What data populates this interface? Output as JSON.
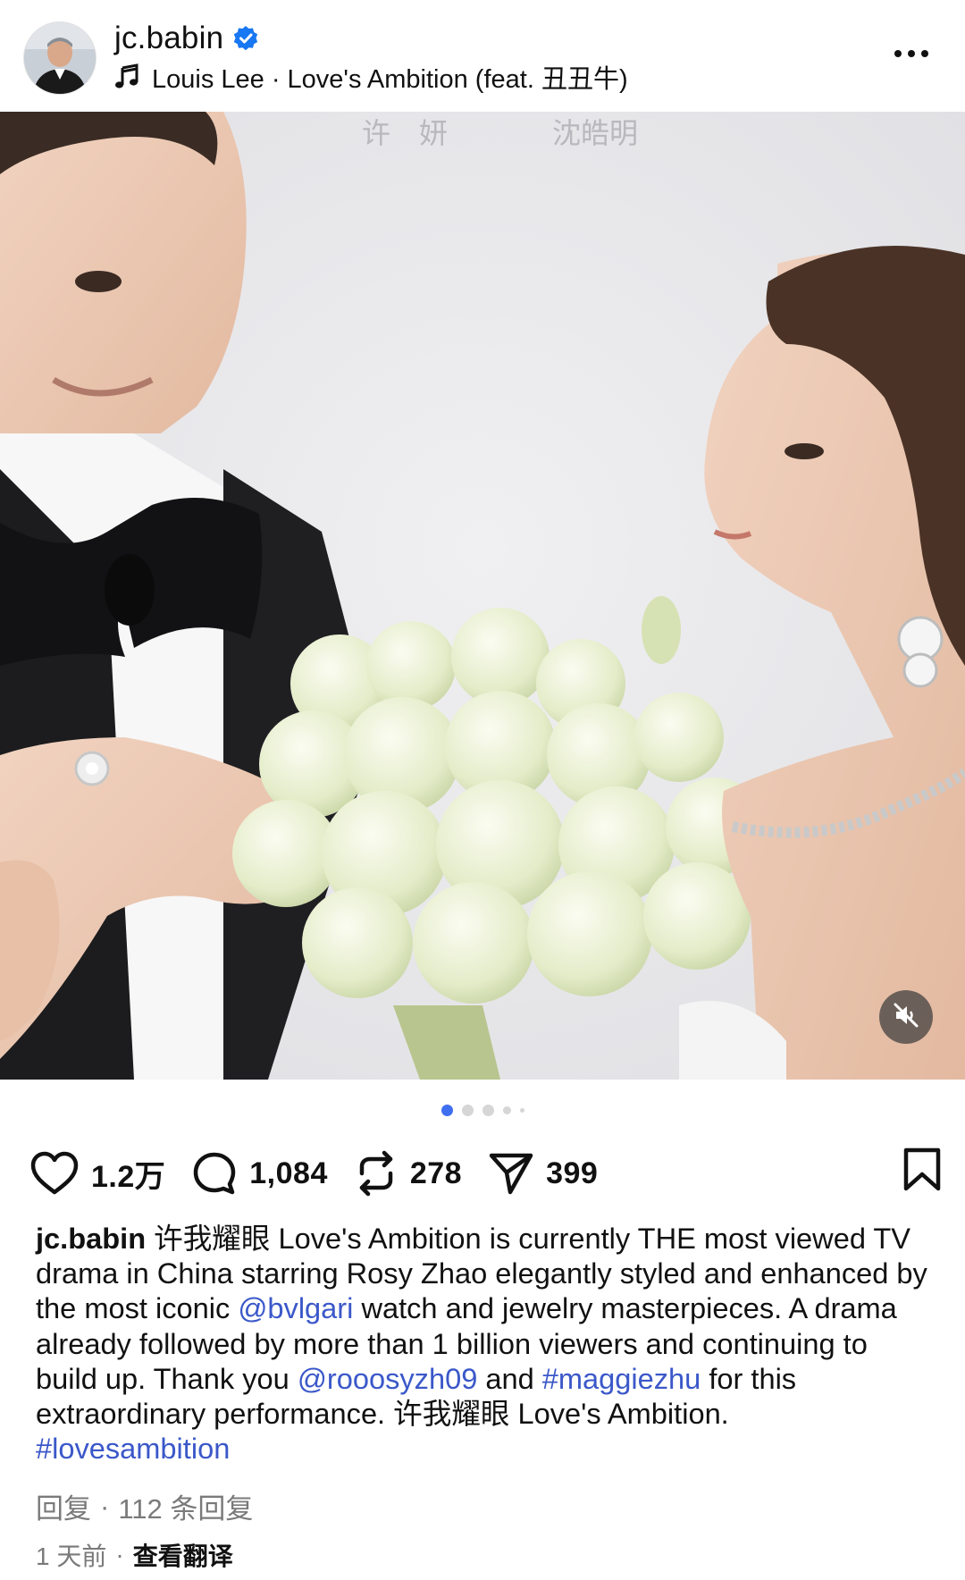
{
  "header": {
    "username": "jc.babin",
    "verified": true,
    "music": "Louis Lee · Love's Ambition (feat. 丑丑牛)",
    "more_icon": "more-horizontal-icon"
  },
  "media": {
    "poster_text_left": "许　妍",
    "poster_text_right": "沈皓明",
    "mute_icon": "speaker-muted-icon"
  },
  "carousel": {
    "total": 5,
    "active": 1
  },
  "actions": {
    "likes": "1.2万",
    "comments": "1,084",
    "reposts": "278",
    "shares": "399",
    "icons": [
      "heart-icon",
      "comment-icon",
      "repost-icon",
      "send-icon",
      "bookmark-icon"
    ]
  },
  "caption": {
    "author": "jc.babin",
    "t1": " 许我耀眼 Love's Ambition is currently THE most viewed TV drama in China starring  Rosy Zhao elegantly styled and enhanced by the most iconic ",
    "link1": "@bvlgari",
    "t2": " watch and jewelry masterpieces. A drama already followed by more than 1 billion viewers and continuing to build up. Thank you ",
    "link2": "@rooosyzh09",
    "t3": " and ",
    "link3": "#maggiezhu",
    "t4": " for this extraordinary performance. 许我耀眼 Love's Ambition. ",
    "link4": "#lovesambition"
  },
  "footer": {
    "reply": "回复",
    "reply_count": "112 条回复",
    "time": "1 天前",
    "translate": "查看翻译",
    "separator": "·"
  },
  "colors": {
    "link": "#3b58c9",
    "verified": "#1877f2",
    "active_dot": "#3f6ff0"
  }
}
